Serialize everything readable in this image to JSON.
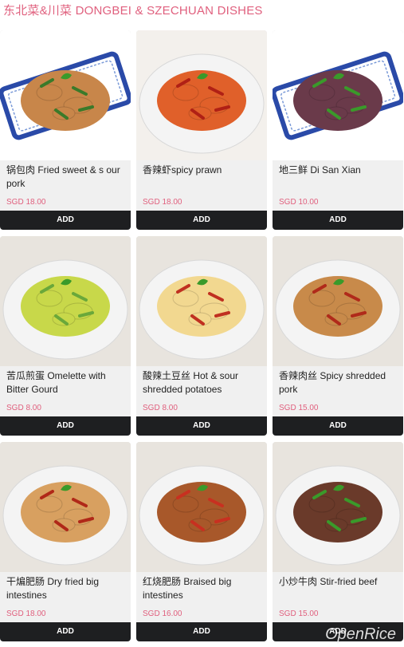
{
  "section_title": "东北菜&川菜 DONGBEI & SZECHUAN DISHES",
  "add_label": "ADD",
  "items": [
    {
      "name": "锅包肉 Fried sweet & s our pork",
      "price": "SGD 18.00",
      "plate": "blue-white",
      "food": "#c8864a",
      "accent": "#3a7a2a"
    },
    {
      "name": "香辣虾spicy prawn",
      "price": "SGD 18.00",
      "plate": "white",
      "food": "#e0602a",
      "accent": "#b02015"
    },
    {
      "name": "地三鲜 Di San Xian",
      "price": "SGD 10.00",
      "plate": "blue-white",
      "food": "#6a3a4a",
      "accent": "#3a9a2a"
    },
    {
      "name": "苦瓜煎蛋 Omelette with Bitter Gourd",
      "price": "SGD 8.00",
      "plate": "white",
      "food": "#c8d84a",
      "accent": "#6aa83a"
    },
    {
      "name": "酸辣土豆丝 Hot & sour shredded potatoes",
      "price": "SGD 8.00",
      "plate": "white",
      "food": "#f2d890",
      "accent": "#c03020"
    },
    {
      "name": "香辣肉丝 Spicy shredded pork",
      "price": "SGD 15.00",
      "plate": "white",
      "food": "#c88a4a",
      "accent": "#b02a1a"
    },
    {
      "name": "干煸肥肠 Dry fried big intestines",
      "price": "SGD 18.00",
      "plate": "white",
      "food": "#d8a060",
      "accent": "#b02818"
    },
    {
      "name": "红烧肥肠 Braised big intestines",
      "price": "SGD 16.00",
      "plate": "white",
      "food": "#a8582a",
      "accent": "#c83020"
    },
    {
      "name": "小炒牛肉 Stir-fried beef",
      "price": "SGD 15.00",
      "plate": "white",
      "food": "#6a3a2a",
      "accent": "#3a9a2a"
    }
  ],
  "watermark": "OpenRice"
}
